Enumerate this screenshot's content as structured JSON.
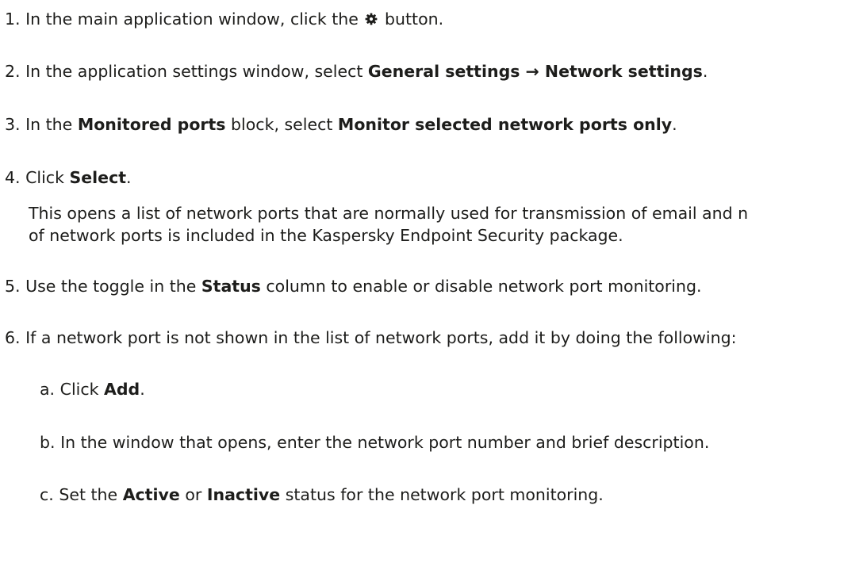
{
  "steps": [
    {
      "number": "1.",
      "text_before": "In the main application window, click the",
      "icon": "gear-icon",
      "text_after": "button."
    },
    {
      "number": "2.",
      "text_before": "In the application settings window, select",
      "bold1": "General settings → Network settings",
      "text_after": "."
    },
    {
      "number": "3.",
      "text_before": "In the",
      "bold1": "Monitored ports",
      "text_mid": "block, select",
      "bold2": "Monitor selected network ports only",
      "text_after": "."
    },
    {
      "number": "4.",
      "text_before": "Click",
      "bold1": "Select",
      "text_after": ".",
      "note_line1": "This opens a list of network ports that are normally used for transmission of email and n",
      "note_line2": "of network ports is included in the Kaspersky Endpoint Security package."
    },
    {
      "number": "5.",
      "text_before": "Use the toggle in the",
      "bold1": "Status",
      "text_after": "column to enable or disable network port monitoring."
    },
    {
      "number": "6.",
      "text_before": "If a network port is not shown in the list of network ports, add it by doing the following:"
    }
  ],
  "substeps": [
    {
      "letter": "a.",
      "text_before": "Click",
      "bold1": "Add",
      "text_after": "."
    },
    {
      "letter": "b.",
      "text_before": "In the window that opens, enter the network port number and brief description."
    },
    {
      "letter": "c.",
      "text_before": "Set the",
      "bold1": "Active",
      "text_mid": "or",
      "bold2": "Inactive",
      "text_after": "status for the network port monitoring."
    }
  ],
  "icon_color": "#1d1d1b"
}
